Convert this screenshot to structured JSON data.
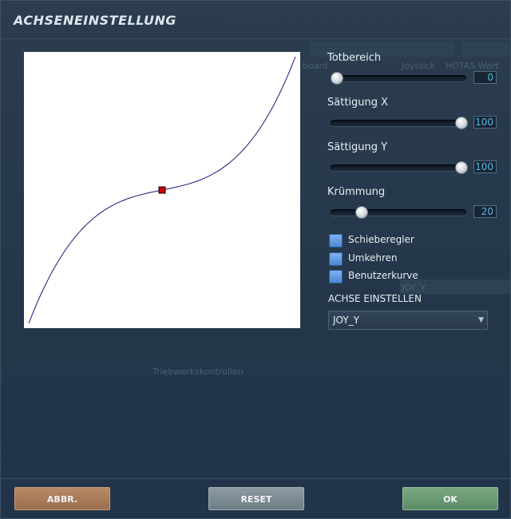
{
  "dialog": {
    "title": "ACHSENEINSTELLUNG"
  },
  "background": {
    "text_joystick": "Joystick",
    "text_hotas": "HOTAS Wart",
    "text_board": "board",
    "text_joy_y": "JOY_Y",
    "text_engine": "Triebwerkskontrollen"
  },
  "sliders": [
    {
      "label": "Totbereich",
      "value": "0",
      "fraction": 0.0
    },
    {
      "label": "Sättigung X",
      "value": "100",
      "fraction": 1.0
    },
    {
      "label": "Sättigung Y",
      "value": "100",
      "fraction": 1.0
    },
    {
      "label": "Krümmung",
      "value": "20",
      "fraction": 0.2
    }
  ],
  "checkboxes": [
    {
      "label": "Schieberegler"
    },
    {
      "label": "Umkehren"
    },
    {
      "label": "Benutzerkurve"
    }
  ],
  "axis": {
    "label": "ACHSE EINSTELLEN",
    "selected": "JOY_Y"
  },
  "buttons": {
    "cancel": "ABBR.",
    "reset": "RESET",
    "ok": "OK"
  },
  "colors": {
    "curve": "#1a1a7a",
    "center_marker": "#cc0000",
    "value_text": "#58b8e8"
  },
  "curve": {
    "curvature": 20
  }
}
